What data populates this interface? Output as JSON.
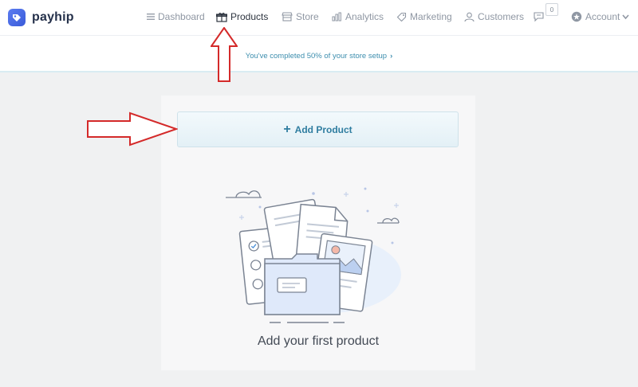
{
  "brand": {
    "name": "payhip"
  },
  "nav": {
    "dashboard": "Dashboard",
    "products": "Products",
    "store": "Store",
    "analytics": "Analytics",
    "marketing": "Marketing",
    "customers": "Customers",
    "notifications_count": "0",
    "account": "Account"
  },
  "setup": {
    "message": "You've completed 50% of your store setup"
  },
  "main": {
    "add_button_label": "Add Product",
    "empty_state_text": "Add your first product"
  },
  "colors": {
    "accent": "#2f7da0",
    "annotation_red": "#d42a2a"
  }
}
